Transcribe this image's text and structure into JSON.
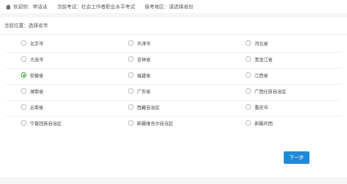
{
  "topbar": {
    "welcome_label": "欢迎你：",
    "user_name": "申洁洁",
    "exam_label": "当前考试：",
    "exam_name": "社会工作者职业水平考试",
    "region_label": "报考地区：",
    "region_value": "请选择省份"
  },
  "location": {
    "label": "当前位置：选择省市"
  },
  "provinces": [
    {
      "label": "北京市",
      "checked": false
    },
    {
      "label": "天津市",
      "checked": false
    },
    {
      "label": "河北省",
      "checked": false
    },
    {
      "label": "大连市",
      "checked": false
    },
    {
      "label": "吉林省",
      "checked": false
    },
    {
      "label": "黑龙江省",
      "checked": false
    },
    {
      "label": "安徽省",
      "checked": true
    },
    {
      "label": "福建省",
      "checked": false
    },
    {
      "label": "江西省",
      "checked": false
    },
    {
      "label": "湖南省",
      "checked": false
    },
    {
      "label": "广东省",
      "checked": false
    },
    {
      "label": "广西壮族自治区",
      "checked": false
    },
    {
      "label": "云南省",
      "checked": false
    },
    {
      "label": "西藏自治区",
      "checked": false
    },
    {
      "label": "重庆市",
      "checked": false
    },
    {
      "label": "宁夏回族自治区",
      "checked": false
    },
    {
      "label": "新疆维吾尔自治区",
      "checked": false
    },
    {
      "label": "新疆兵团",
      "checked": false
    }
  ],
  "actions": {
    "next_label": "下一步"
  },
  "colors": {
    "accent": "#1f8ad6",
    "radio_selected": "#3fa33f"
  }
}
